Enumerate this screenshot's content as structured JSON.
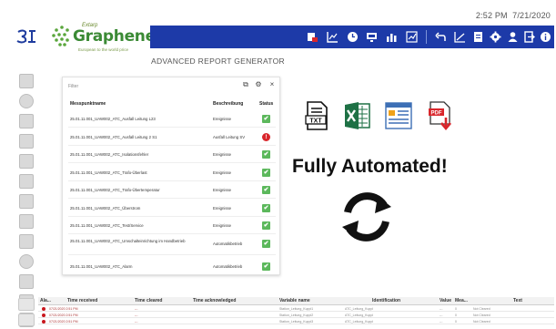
{
  "statusbar": {
    "time": "2:52 PM",
    "date": "7/21/2020"
  },
  "brand": {
    "extarp": "Extarp",
    "name": "Graphene",
    "tagline": "European to the world price"
  },
  "navbar": {
    "icons_left": [
      "alarm-icon",
      "chart-icon",
      "clock-icon",
      "monitor-icon",
      "bar-chart-icon",
      "trend-icon"
    ],
    "icons_right": [
      "back-icon",
      "line-chart-icon",
      "document-icon",
      "settings-icon",
      "user-icon",
      "logout-icon",
      "info-icon"
    ]
  },
  "page": {
    "title": "ADVANCED REPORT GENERATOR"
  },
  "panel": {
    "search_placeholder": "Filter",
    "columns": {
      "name": "Messpunktname",
      "desc": "Beschreibung",
      "status": "Status"
    },
    "rows": [
      {
        "name": "25.01.11.001_UAW002_ATC_Ausfall Leitung L23",
        "desc": "Ereignisse",
        "status": "ok"
      },
      {
        "name": "25.01.11.001_UAW002_ATC_Ausfall Leitung 2 S1",
        "desc": "Ausfall Leitung SV",
        "status": "error"
      },
      {
        "name": "25.01.11.001_UAW002_ATC_Isolationsfehler",
        "desc": "Ereignisse",
        "status": "ok"
      },
      {
        "name": "25.01.11.001_UAW002_ATC_Trafo-Überlast",
        "desc": "Ereignisse",
        "status": "ok"
      },
      {
        "name": "25.01.11.001_UAW002_ATC_Trafo-Übertemperatur",
        "desc": "Ereignisse",
        "status": "ok"
      },
      {
        "name": "25.01.11.001_UAW002_ATC_Überstrom",
        "desc": "Ereignisse",
        "status": "ok"
      },
      {
        "name": "25.01.11.001_UAW002_ATC_Test/Service",
        "desc": "Ereignisse",
        "status": "ok"
      },
      {
        "name": "25.01.11.001_UAW002_ATC_Umschalteinrichtung im Handbetrieb",
        "desc": "Automatikbetrieb",
        "status": "ok"
      },
      {
        "name": "25.01.11.001_UAW002_ATC_Alarm",
        "desc": "Automatikbetrieb",
        "status": "ok"
      }
    ],
    "check_glyph": "✔",
    "error_glyph": "!"
  },
  "formats": [
    "txt-file-icon",
    "excel-file-icon",
    "web-page-icon",
    "pdf-download-icon"
  ],
  "format_labels": {
    "txt": "TXT",
    "pdf": "PDF"
  },
  "hero": {
    "title": "Fully Automated!"
  },
  "alarm_table": {
    "columns": [
      "Ala...",
      "Time received",
      "Time cleared",
      "Time acknowledged",
      "Variable name",
      "Identification",
      "Value",
      "Mea...",
      "Text"
    ],
    "rows": [
      [
        "",
        "07/21/2020 2:51 PM",
        "---",
        "",
        "Station_Leitung_Kuppl1",
        "ATC_Leitung_Kuppl",
        "---",
        "0",
        "Not Cleared"
      ],
      [
        "",
        "07/21/2020 2:51 PM",
        "---",
        "",
        "Station_Leitung_Kuppl2",
        "ATC_Leitung_Kuppl",
        "---",
        "0",
        "Not Cleared"
      ],
      [
        "",
        "07/21/2020 2:51 PM",
        "---",
        "",
        "Station_Leitung_Kuppl3",
        "ATC_Leitung_Kuppl",
        "---",
        "0",
        "Not Cleared"
      ]
    ]
  },
  "colors": {
    "navbar": "#1d3aa8",
    "ok": "#5cb85c",
    "error": "#d9262c",
    "brand_green": "#3b8a35"
  }
}
